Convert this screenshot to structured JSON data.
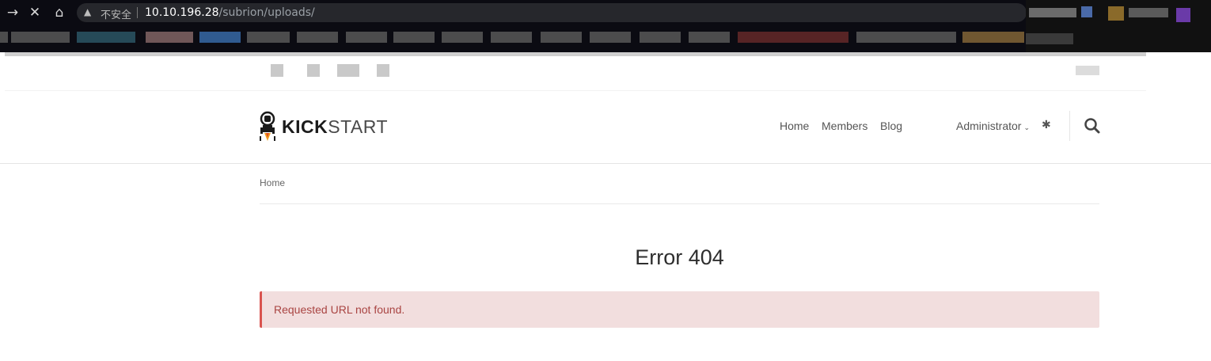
{
  "browser": {
    "insecure_label": "不安全",
    "url_host": "10.10.196.28",
    "url_path": "/subrion/uploads/",
    "back_icon": "→",
    "stop_icon": "✕",
    "home_icon": "⌂",
    "warning_icon": "▲"
  },
  "header": {
    "logo_bold": "KICK",
    "logo_light": "START",
    "nav": {
      "home": "Home",
      "members": "Members",
      "blog": "Blog",
      "admin": "Administrator",
      "admin_caret": "⌄"
    },
    "gear_icon": "✱",
    "search_icon": "search-icon"
  },
  "breadcrumb": {
    "home": "Home"
  },
  "main": {
    "title": "Error 404",
    "alert": "Requested URL not found."
  },
  "colors": {
    "alert_bg": "#f2dede",
    "alert_text": "#a94442",
    "alert_border": "#d9534f"
  }
}
